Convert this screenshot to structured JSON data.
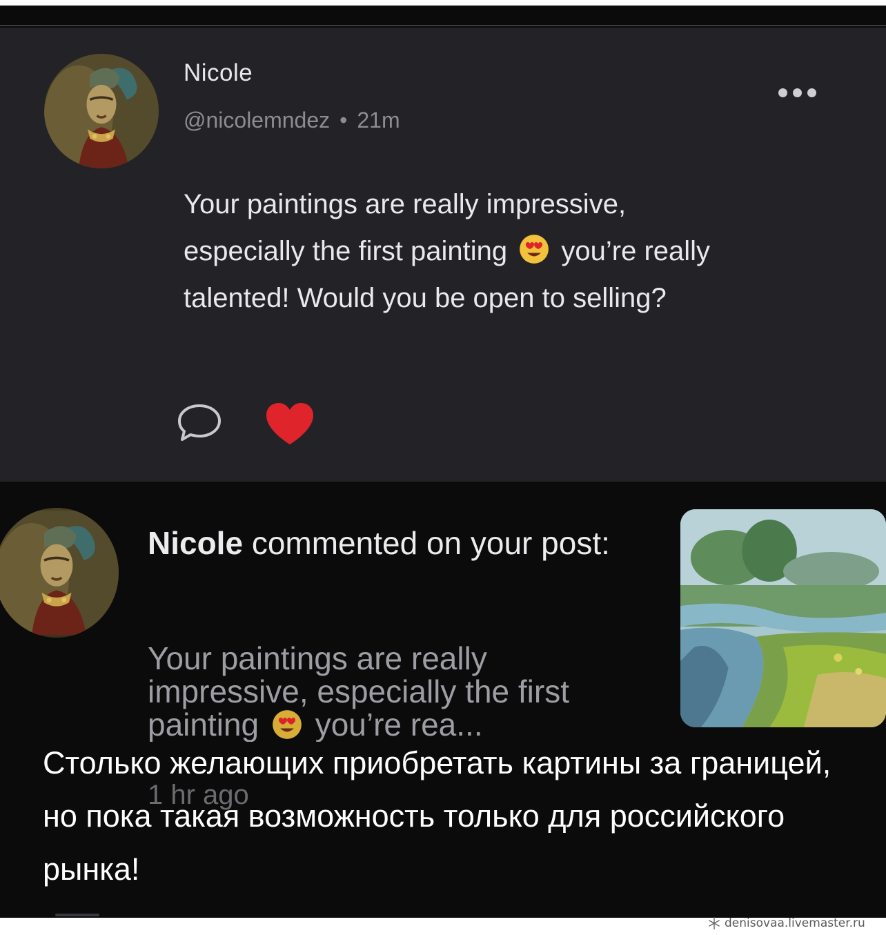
{
  "post": {
    "author_name": "Nicole",
    "handle": "@nicolemndez",
    "separator": "•",
    "time": "21m",
    "text_part1": "Your paintings are really impressive, especially the first painting",
    "text_part2": "you’re really talented! Would you be open to selling?",
    "emoji": "heart-eyes-emoji",
    "actions": [
      "comment-icon",
      "heart-icon"
    ],
    "like_color": "#e0242b"
  },
  "notification": {
    "author_name": "Nicole",
    "title_rest": "commented on your post:",
    "preview_part1": "Your paintings are really impressive, especially the first painting",
    "preview_part2": "you’re rea...",
    "time": "1 hr ago"
  },
  "caption": "Столько желающих приобретать картины за границей, но пока такая возможность только для российского рынка!",
  "watermark": "denisovaa.livemaster.ru",
  "colors": {
    "card_bg": "#232327",
    "page_bg": "#0b0b0c",
    "text_primary": "#e9e9ec",
    "text_muted": "#8c8c92"
  }
}
